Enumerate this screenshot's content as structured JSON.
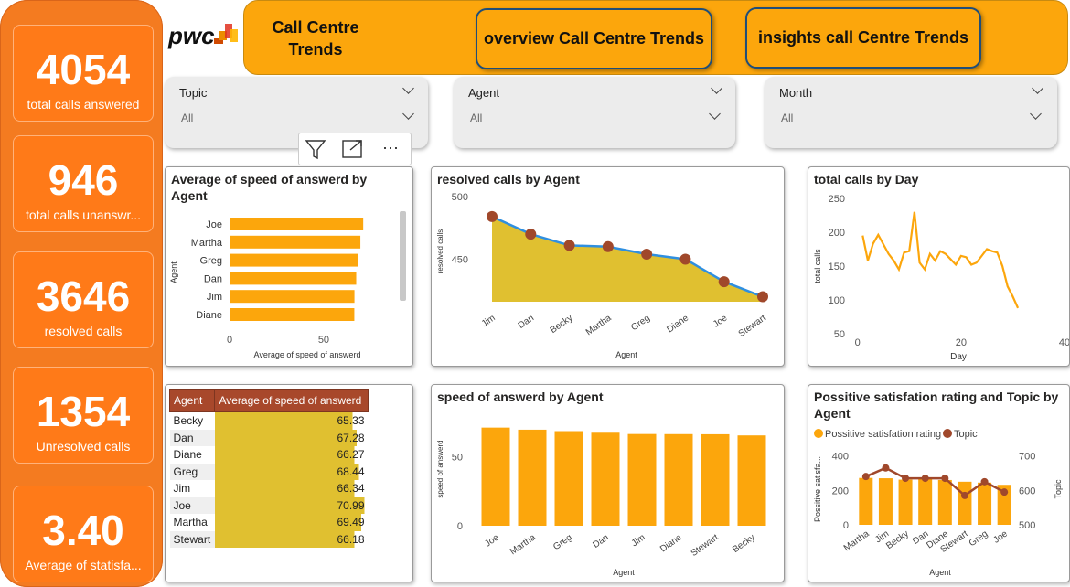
{
  "kpis": [
    {
      "value": "4054",
      "label": "total calls answered"
    },
    {
      "value": "946",
      "label": "total calls unanswr..."
    },
    {
      "value": "3646",
      "label": "resolved calls"
    },
    {
      "value": "1354",
      "label": "Unresolved calls"
    },
    {
      "value": "3.40",
      "label": "Average of statisfa..."
    }
  ],
  "header": {
    "title_line1": "Call Centre",
    "title_line2": "Trends",
    "btn_overview": "overview Call Centre Trends",
    "btn_insights": "insights call Centre Trends",
    "logo_text": "pwc"
  },
  "slicers": [
    {
      "title": "Topic",
      "value": "All"
    },
    {
      "title": "Agent",
      "value": "All"
    },
    {
      "title": "Month",
      "value": "All"
    }
  ],
  "toolbar": {
    "more": "⋯"
  },
  "colors": {
    "orange": "#FCA60C",
    "rail": "#F47B20",
    "olive": "#E0C030",
    "blue": "#2F8FE0",
    "brown": "#A0482B"
  },
  "chart_data": [
    {
      "id": "speed_by_agent_hbar",
      "type": "bar",
      "title": "Average of speed of answerd by Agent",
      "categories": [
        "Joe",
        "Martha",
        "Greg",
        "Dan",
        "Jim",
        "Diane"
      ],
      "values": [
        70.99,
        69.49,
        68.44,
        67.28,
        66.34,
        66.27
      ],
      "xlabel": "Average of speed of answerd",
      "ylabel": "Agent",
      "xticks": [
        "0",
        "50"
      ],
      "xlim": [
        0,
        85
      ]
    },
    {
      "id": "resolved_by_agent_area",
      "type": "area",
      "title": "resolved calls by Agent",
      "categories": [
        "Jim",
        "Dan",
        "Becky",
        "Martha",
        "Greg",
        "Diane",
        "Joe",
        "Stewart"
      ],
      "values": [
        484,
        470,
        461,
        460,
        454,
        450,
        432,
        420
      ],
      "xlabel": "Agent",
      "ylabel": "resolved calls",
      "yticks": [
        "500",
        "450"
      ],
      "ylim": [
        416,
        500
      ]
    },
    {
      "id": "calls_by_day_line",
      "type": "line",
      "title": "total calls by Day",
      "x": [
        1,
        2,
        3,
        4,
        5,
        6,
        7,
        8,
        9,
        10,
        11,
        12,
        13,
        14,
        15,
        16,
        17,
        18,
        19,
        20,
        21,
        22,
        23,
        24,
        25,
        26,
        27,
        28,
        29,
        30,
        31
      ],
      "y": [
        195,
        158,
        183,
        196,
        182,
        168,
        158,
        145,
        170,
        172,
        230,
        155,
        145,
        168,
        158,
        172,
        168,
        160,
        152,
        165,
        163,
        152,
        155,
        165,
        175,
        172,
        170,
        150,
        120,
        105,
        88
      ],
      "xlabel": "Day",
      "ylabel": "total calls",
      "xlim": [
        -1,
        40
      ],
      "ylim": [
        50,
        258
      ],
      "xticks": [
        "0",
        "20",
        "40"
      ],
      "yticks": [
        "250",
        "200",
        "150",
        "100",
        "50"
      ]
    },
    {
      "id": "speed_table",
      "type": "table",
      "columns": [
        "Agent",
        "Average of speed of answerd"
      ],
      "rows": [
        [
          "Becky",
          "65.33"
        ],
        [
          "Dan",
          "67.28"
        ],
        [
          "Diane",
          "66.27"
        ],
        [
          "Greg",
          "68.44"
        ],
        [
          "Jim",
          "66.34"
        ],
        [
          "Joe",
          "70.99"
        ],
        [
          "Martha",
          "69.49"
        ],
        [
          "Stewart",
          "66.18"
        ]
      ],
      "bar_max": 73
    },
    {
      "id": "speed_by_agent_vbar",
      "type": "bar",
      "title": "speed of answerd by Agent",
      "categories": [
        "Joe",
        "Martha",
        "Greg",
        "Dan",
        "Jim",
        "Diane",
        "Stewart",
        "Becky"
      ],
      "values": [
        70.99,
        69.49,
        68.44,
        67.28,
        66.34,
        66.27,
        66.18,
        65.33
      ],
      "xlabel": "Agent",
      "ylabel": "speed of answerd",
      "yticks": [
        "50",
        "0"
      ],
      "ylim": [
        0,
        82
      ]
    },
    {
      "id": "satisfaction_topic_combo",
      "type": "bar",
      "title": "Possitive satisfation rating and Topic by Agent",
      "categories": [
        "Martha",
        "Jim",
        "Becky",
        "Dan",
        "Diane",
        "Stewart",
        "Greg",
        "Joe"
      ],
      "series": [
        {
          "name": "Possitive satisfation rating",
          "values": [
            272,
            270,
            262,
            265,
            260,
            250,
            245,
            232
          ]
        },
        {
          "name": "Topic",
          "values": [
            640,
            665,
            635,
            635,
            635,
            585,
            625,
            595
          ]
        }
      ],
      "xlabel": "Agent",
      "ylabel": "Possitive satisfa...",
      "ylabel_right": "Topic",
      "yticks": [
        "400",
        "200",
        "0"
      ],
      "yticks_right": [
        "700",
        "600",
        "500"
      ],
      "ylim": [
        0,
        440
      ],
      "ylim_right": [
        500,
        720
      ]
    }
  ]
}
